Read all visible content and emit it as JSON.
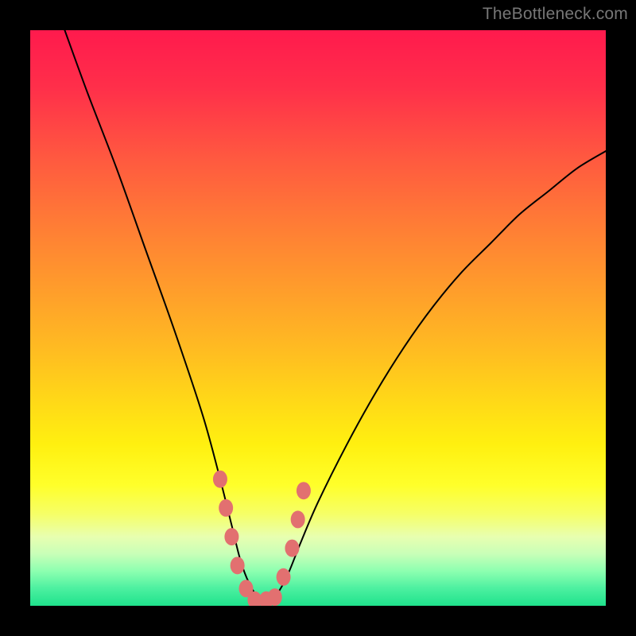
{
  "watermark": "TheBottleneck.com",
  "chart_data": {
    "type": "line",
    "title": "",
    "xlabel": "",
    "ylabel": "",
    "xlim": [
      0,
      100
    ],
    "ylim": [
      0,
      100
    ],
    "grid": false,
    "legend": false,
    "series": [
      {
        "name": "bottleneck-curve",
        "x": [
          6,
          10,
          15,
          20,
          25,
          30,
          33,
          35,
          36.5,
          38,
          40,
          42,
          43.5,
          45,
          47,
          50,
          55,
          60,
          65,
          70,
          75,
          80,
          85,
          90,
          95,
          100
        ],
        "values": [
          100,
          89,
          76,
          62,
          48,
          33,
          22,
          14,
          8,
          4,
          1,
          1,
          3,
          6,
          11,
          18,
          28,
          37,
          45,
          52,
          58,
          63,
          68,
          72,
          76,
          79
        ]
      }
    ],
    "markers": [
      {
        "x": 33.0,
        "y": 22
      },
      {
        "x": 34.0,
        "y": 17
      },
      {
        "x": 35.0,
        "y": 12
      },
      {
        "x": 36.0,
        "y": 7
      },
      {
        "x": 37.5,
        "y": 3
      },
      {
        "x": 39.0,
        "y": 1
      },
      {
        "x": 41.0,
        "y": 1
      },
      {
        "x": 42.5,
        "y": 1.5
      },
      {
        "x": 44.0,
        "y": 5
      },
      {
        "x": 45.5,
        "y": 10
      },
      {
        "x": 46.5,
        "y": 15
      },
      {
        "x": 47.5,
        "y": 20
      }
    ],
    "background_gradient": {
      "direction": "top-to-bottom",
      "stops": [
        {
          "pos": 0,
          "color": "#ff1a4d"
        },
        {
          "pos": 50,
          "color": "#ffba22"
        },
        {
          "pos": 80,
          "color": "#ffff2a"
        },
        {
          "pos": 100,
          "color": "#1fe28c"
        }
      ]
    }
  }
}
